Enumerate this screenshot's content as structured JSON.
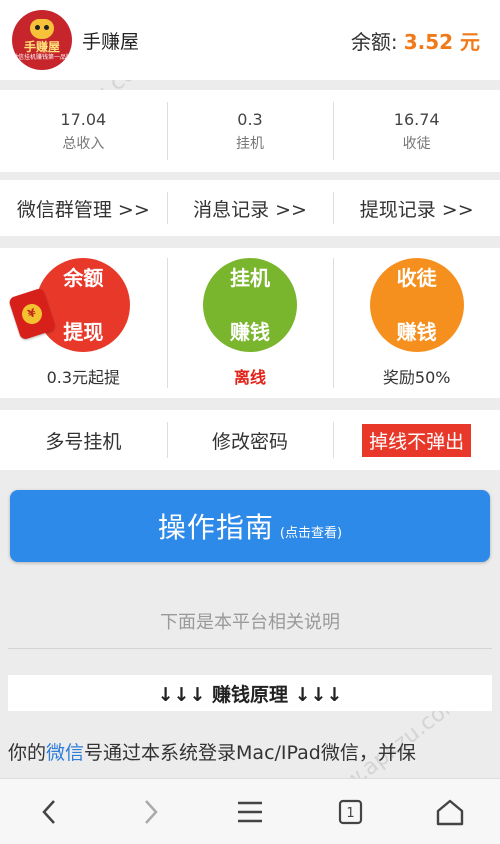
{
  "header": {
    "logo_text": "手赚屋",
    "logo_sub": "微信挂机赚钱第一品牌",
    "app_name": "手赚屋",
    "balance_label": "余额:",
    "balance_value": "3.52 元"
  },
  "stats": [
    {
      "value": "17.04",
      "label": "总收入"
    },
    {
      "value": "0.3",
      "label": "挂机"
    },
    {
      "value": "16.74",
      "label": "收徒"
    }
  ],
  "links": [
    {
      "label": "微信群管理 >>"
    },
    {
      "label": "消息记录 >>"
    },
    {
      "label": "提现记录 >>"
    }
  ],
  "actions": [
    {
      "line1": "余额",
      "line2": "提现",
      "sub": "0.3元起提",
      "color": "#e8382a"
    },
    {
      "line1": "挂机",
      "line2": "赚钱",
      "sub": "离线",
      "color": "#7ab52e"
    },
    {
      "line1": "收徒",
      "line2": "赚钱",
      "sub": "奖励50%",
      "color": "#f5901e"
    }
  ],
  "toolbar": [
    {
      "label": "多号挂机"
    },
    {
      "label": "修改密码"
    },
    {
      "label": "掉线不弹出"
    }
  ],
  "guide": {
    "title": "操作指南",
    "hint": "(点击查看)"
  },
  "note": "下面是本平台相关说明",
  "principle": "↓↓↓ 赚钱原理 ↓↓↓",
  "paragraph": {
    "prefix": "你的",
    "highlight": "微信",
    "rest": "号通过本系统登录Mac/IPad微信，并保"
  },
  "watermark": "www.apkzu.com",
  "nav": {
    "icons": [
      "back-icon",
      "forward-icon",
      "menu-icon",
      "tabs-icon",
      "home-icon"
    ],
    "tab_count": "1"
  }
}
